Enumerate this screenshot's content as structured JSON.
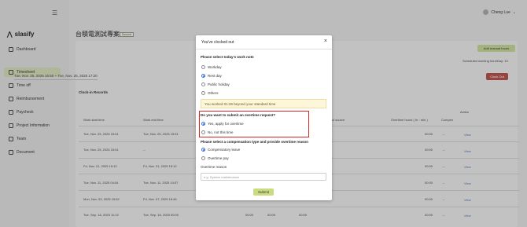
{
  "sidebar": {
    "logo": "slasify",
    "items": [
      {
        "label": "Dashboard"
      },
      {
        "label": "Timesheet"
      },
      {
        "label": "Time off"
      },
      {
        "label": "Reimbursement"
      },
      {
        "label": "Paycheck"
      },
      {
        "label": "Project Information"
      },
      {
        "label": "Team"
      },
      {
        "label": "Document"
      }
    ]
  },
  "header": {
    "user_name": "Cheng Lue"
  },
  "page": {
    "title": "台積電測試專案",
    "badge": "Ssound",
    "date_range": "Tue, Nov. 25, 2025 16:50 ~ Tue, Nov. 25, 2025 17:20",
    "add_manual_hours": "Add manual hours",
    "scheduled_hours": "Scheduled working hour/Day: 10",
    "clock_out": "Clock Out",
    "section_title": "Clock-in Records"
  },
  "table": {
    "headers": [
      "Work start time",
      "Work end time",
      "ul source",
      "Overtime hours ( hr : min )",
      "Compen",
      "Action"
    ],
    "rows": [
      {
        "start": "Tue, Nov. 25, 2025 15:51",
        "end": "Tue, Nov. 25, 2025 15:51",
        "ot": "00:00",
        "comp": "--",
        "action": "View"
      },
      {
        "start": "Tue, Nov. 25, 2025 15:51",
        "end": "--",
        "ot": "00:00",
        "comp": "--",
        "action": "View"
      },
      {
        "start": "Fri, Nov. 21, 2025 15:12",
        "end": "Fri, Nov. 21, 2025 15:12",
        "ot": "00:00",
        "comp": "--",
        "action": "View"
      },
      {
        "start": "Tue, Nov. 11, 2025 04:04",
        "end": "Tue, Nov. 11, 2025 14:07",
        "ot": "00:00",
        "comp": "--",
        "action": "View"
      },
      {
        "start": "Mon, Nov. 03, 2025 15:52",
        "end": "Fri, Nov. 07, 2025 16:46",
        "ot": "00:00",
        "comp": "--",
        "action": "View"
      },
      {
        "start": "Tue, Sep. 16, 2025 11:12",
        "end": "Tue, Sep. 16, 2025 00:00",
        "ot": "00:00",
        "comp": "--",
        "action": "View"
      }
    ],
    "extra_cells": [
      "00:00",
      "00:00",
      "00:00"
    ]
  },
  "modal": {
    "title": "You've clocked out",
    "close": "×",
    "q1": "Please select today's work note",
    "work_notes": [
      {
        "label": "Workday",
        "selected": false
      },
      {
        "label": "Rest day",
        "selected": true
      },
      {
        "label": "Public holiday",
        "selected": false
      },
      {
        "label": "Others",
        "selected": false
      }
    ],
    "notice": "You worked 01:28 beyond your standard time",
    "q2": "Do you want to submit an overtime request?",
    "overtime_options": [
      {
        "label": "Yes, apply for overtime",
        "selected": true
      },
      {
        "label": "No, not this time",
        "selected": false
      }
    ],
    "q3": "Please select a compensation type and provide overtime reason",
    "compensation_options": [
      {
        "label": "Compensatory leave",
        "selected": true
      },
      {
        "label": "Overtime pay",
        "selected": false
      }
    ],
    "reason_label": "Overtime reason",
    "reason_placeholder": "e.g. System maintenance",
    "submit": "Submit"
  },
  "colors": {
    "accent": "#3b6fd4",
    "highlight": "#dd2222",
    "submit": "#c9dc80"
  }
}
